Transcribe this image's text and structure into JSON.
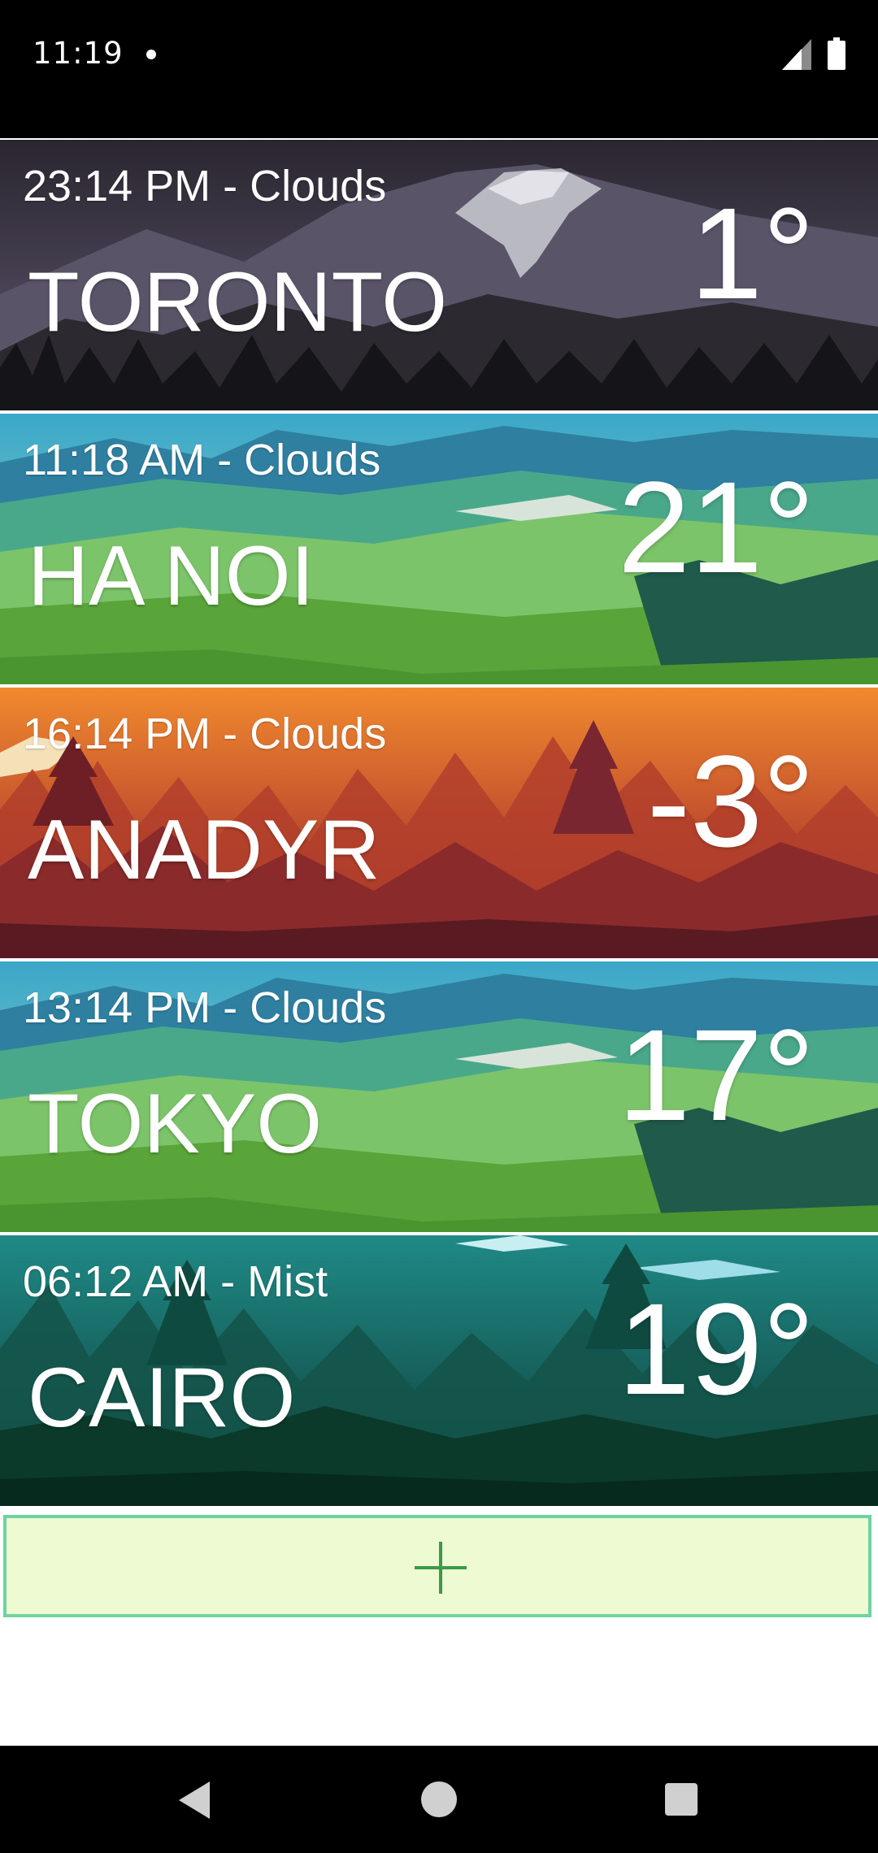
{
  "status_bar": {
    "time": "11:19"
  },
  "cities": [
    {
      "meta": "23:14 PM - Clouds",
      "name": "TORONTO",
      "temp": "1°",
      "theme": "night-mountain"
    },
    {
      "meta": "11:18 AM - Clouds",
      "name": "HA NOI",
      "temp": "21°",
      "theme": "green-valley"
    },
    {
      "meta": "16:14 PM - Clouds",
      "name": "ANADYR",
      "temp": "-3°",
      "theme": "sunset-forest"
    },
    {
      "meta": "13:14 PM - Clouds",
      "name": "TOKYO",
      "temp": "17°",
      "theme": "green-valley"
    },
    {
      "meta": "06:12 AM - Mist",
      "name": "CAIRO",
      "temp": "19°",
      "theme": "teal-forest"
    }
  ],
  "add_button": {
    "icon": "plus-icon"
  },
  "nav_bar": {
    "icons": [
      "back-icon",
      "home-icon",
      "recents-icon"
    ]
  },
  "colors": {
    "add_button_bg": "#eefad2",
    "add_button_border": "#6fd3a0",
    "plus_icon": "#3a9a4a"
  }
}
